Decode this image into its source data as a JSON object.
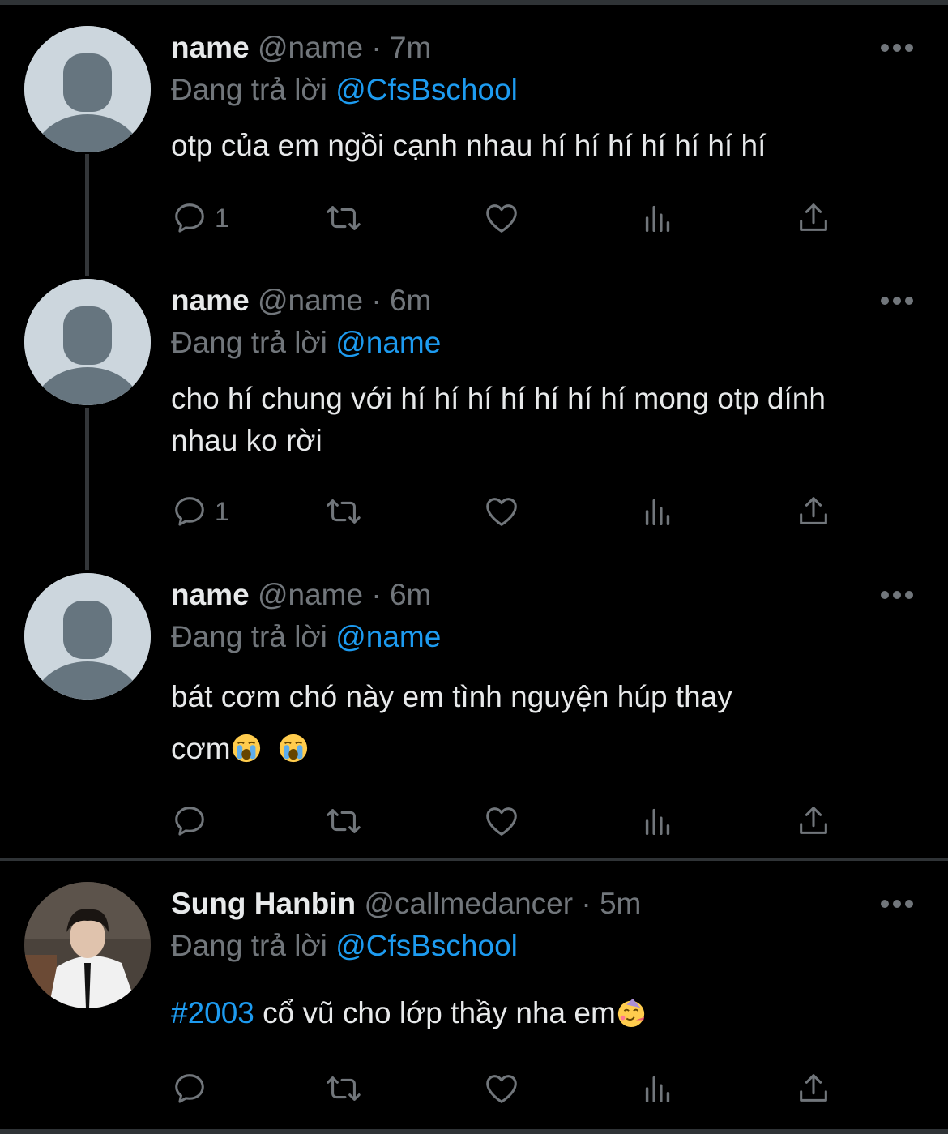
{
  "colors": {
    "background": "#000000",
    "accent": "#1d9bf0",
    "muted": "#71767b",
    "text": "#e7e9ea",
    "divider": "#2f3336"
  },
  "tweets": [
    {
      "name": "name",
      "handle": "@name",
      "sep": "·",
      "time": "7m",
      "replying_label": "Đang trả lời",
      "replying_to": "@CfsBschool",
      "text": "otp của em ngồi cạnh nhau hí hí hí hí hí hí hí",
      "reply_count": "1",
      "avatar": "default-avatar"
    },
    {
      "name": "name",
      "handle": "@name",
      "sep": "·",
      "time": "6m",
      "replying_label": "Đang trả lời",
      "replying_to": "@name",
      "text": "cho hí chung với hí hí hí hí hí hí hí mong otp dính nhau ko rời",
      "reply_count": "1",
      "avatar": "default-avatar"
    },
    {
      "name": "name",
      "handle": "@name",
      "sep": "·",
      "time": "6m",
      "replying_label": "Đang trả lời",
      "replying_to": "@name",
      "text_line1": "bát cơm chó này em tình nguyện húp thay",
      "text_line2": "cơm",
      "emoji": "loudly-crying-face",
      "reply_count": "",
      "avatar": "default-avatar"
    },
    {
      "name": "Sung Hanbin",
      "handle": "@callmedancer",
      "sep": "·",
      "time": "5m",
      "replying_label": "Đang trả lời",
      "replying_to": "@CfsBschool",
      "hashtag": "#2003",
      "text": " cổ vũ cho lớp thầy nha em",
      "emoji": "partying-face",
      "reply_count": "",
      "avatar": "photo-avatar"
    }
  ],
  "icons": [
    "reply-icon",
    "retweet-icon",
    "like-icon",
    "views-icon",
    "share-icon",
    "more-icon"
  ]
}
